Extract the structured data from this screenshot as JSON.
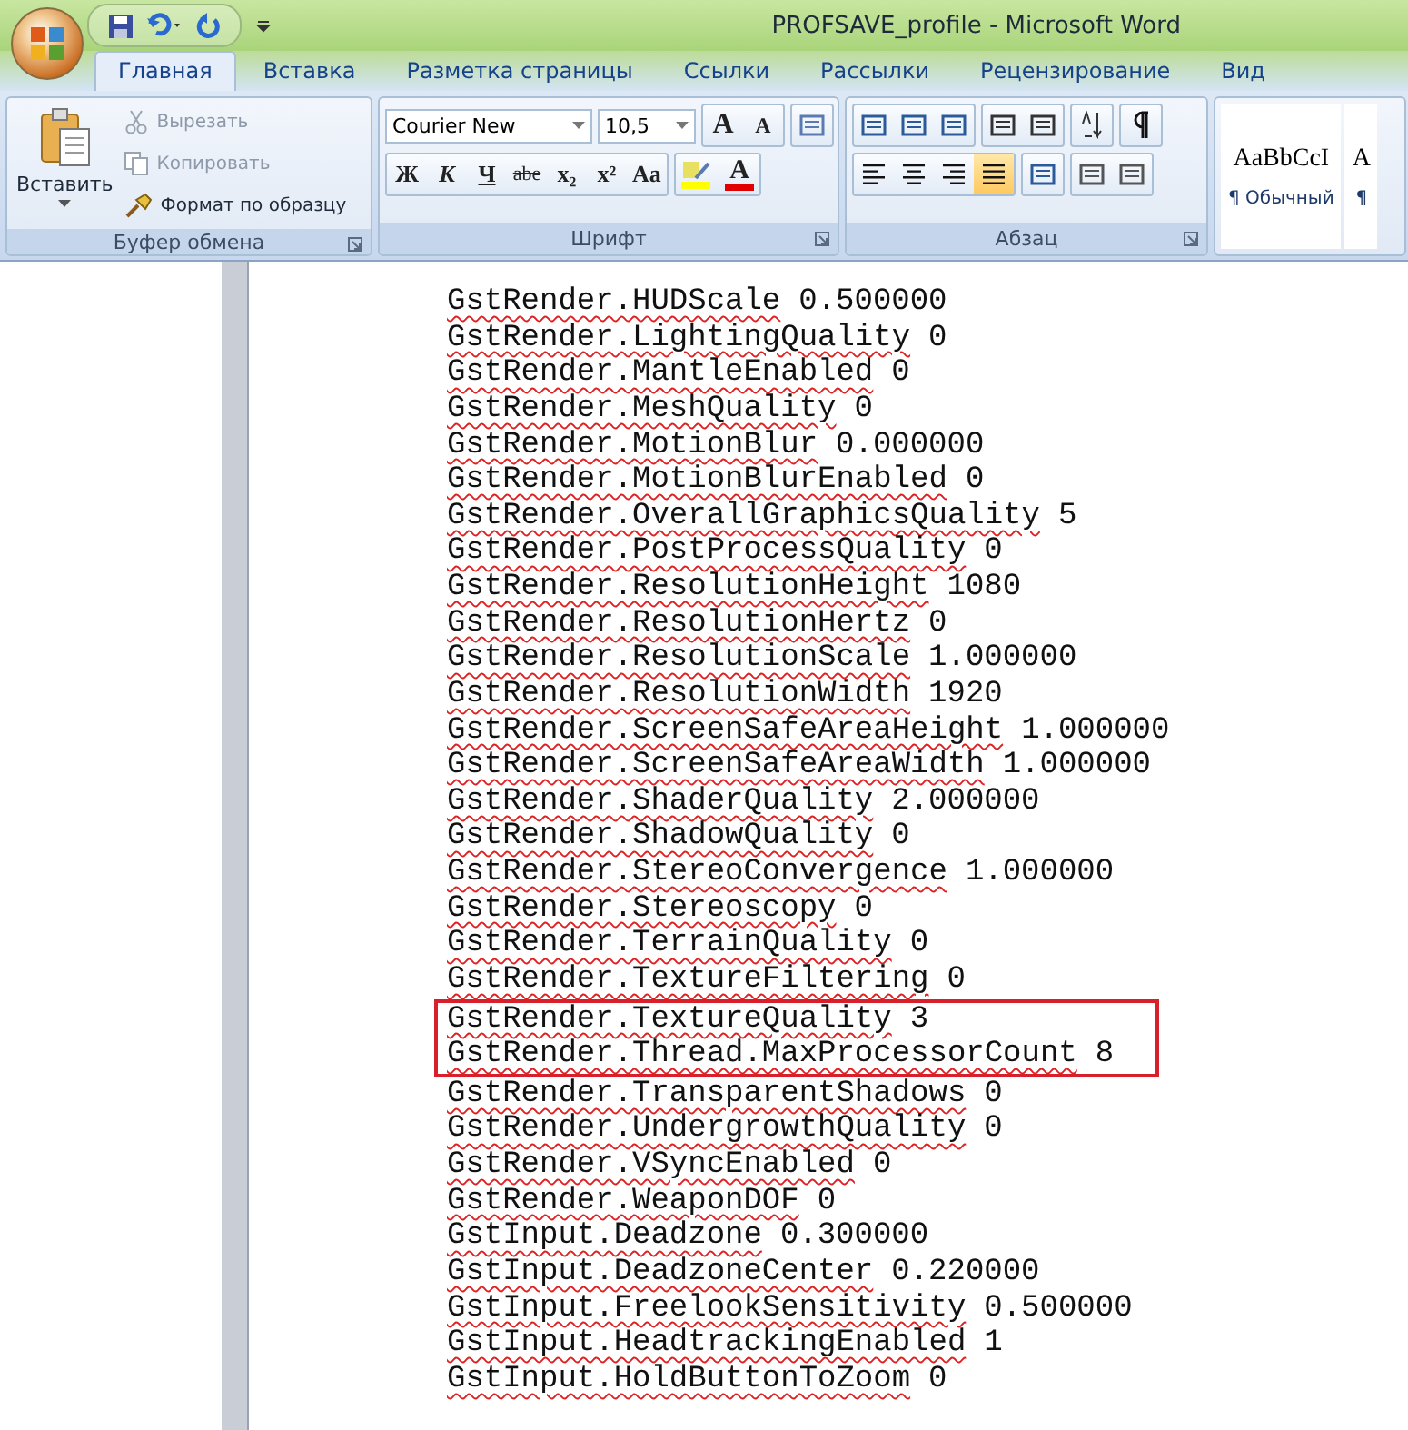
{
  "window": {
    "title": "PROFSAVE_profile - Microsoft Word"
  },
  "tabs": [
    {
      "label": "Главная",
      "selected": true
    },
    {
      "label": "Вставка",
      "selected": false
    },
    {
      "label": "Разметка страницы",
      "selected": false
    },
    {
      "label": "Ссылки",
      "selected": false
    },
    {
      "label": "Рассылки",
      "selected": false
    },
    {
      "label": "Рецензирование",
      "selected": false
    },
    {
      "label": "Вид",
      "selected": false
    }
  ],
  "clipboard": {
    "label": "Буфер обмена",
    "paste": "Вставить",
    "cut": {
      "label": "Вырезать",
      "disabled": true
    },
    "copy": {
      "label": "Копировать",
      "disabled": true
    },
    "painter": {
      "label": "Формат по образцу",
      "disabled": false
    }
  },
  "font": {
    "label": "Шрифт",
    "name": "Courier New",
    "size": "10,5",
    "grow": "A",
    "shrink": "A",
    "bold": "Ж",
    "italic": "К",
    "underline": "Ч",
    "strike": "abe",
    "subscript": "x₂",
    "superscript": "x²",
    "case": "Aa",
    "color_letter": "A"
  },
  "paragraph": {
    "label": "Абзац",
    "align": [
      {
        "kind": "left",
        "selected": false
      },
      {
        "kind": "center",
        "selected": false
      },
      {
        "kind": "right",
        "selected": false
      },
      {
        "kind": "justify",
        "selected": true
      }
    ]
  },
  "styles": [
    {
      "sample": "AaBbCcI",
      "name": "¶ Обычный"
    },
    {
      "sample": "A",
      "name": "¶"
    }
  ],
  "document": {
    "lines": [
      {
        "key": "GstRender.HUDScale",
        "value": "0.500000",
        "boxed": false
      },
      {
        "key": "GstRender.LightingQuality",
        "value": "0",
        "boxed": false
      },
      {
        "key": "GstRender.MantleEnabled",
        "value": "0",
        "boxed": false
      },
      {
        "key": "GstRender.MeshQuality",
        "value": "0",
        "boxed": false
      },
      {
        "key": "GstRender.MotionBlur",
        "value": "0.000000",
        "boxed": false
      },
      {
        "key": "GstRender.MotionBlurEnabled",
        "value": "0",
        "boxed": false
      },
      {
        "key": "GstRender.OverallGraphicsQuality",
        "value": "5",
        "boxed": false
      },
      {
        "key": "GstRender.PostProcessQuality",
        "value": "0",
        "boxed": false
      },
      {
        "key": "GstRender.ResolutionHeight",
        "value": "1080",
        "boxed": false
      },
      {
        "key": "GstRender.ResolutionHertz",
        "value": "0",
        "boxed": false
      },
      {
        "key": "GstRender.ResolutionScale",
        "value": "1.000000",
        "boxed": false
      },
      {
        "key": "GstRender.ResolutionWidth",
        "value": "1920",
        "boxed": false
      },
      {
        "key": "GstRender.ScreenSafeAreaHeight",
        "value": "1.000000",
        "boxed": false
      },
      {
        "key": "GstRender.ScreenSafeAreaWidth",
        "value": "1.000000",
        "boxed": false
      },
      {
        "key": "GstRender.ShaderQuality",
        "value": "2.000000",
        "boxed": false
      },
      {
        "key": "GstRender.ShadowQuality",
        "value": "0",
        "boxed": false
      },
      {
        "key": "GstRender.StereoConvergence",
        "value": "1.000000",
        "boxed": false
      },
      {
        "key": "GstRender.Stereoscopy",
        "value": "0",
        "boxed": false
      },
      {
        "key": "GstRender.TerrainQuality",
        "value": "0",
        "boxed": false
      },
      {
        "key": "GstRender.TextureFiltering",
        "value": "0",
        "boxed": false
      },
      {
        "key": "GstRender.TextureQuality",
        "value": "3",
        "boxed": true
      },
      {
        "key": "GstRender.Thread.MaxProcessorCount",
        "value": "8",
        "boxed": true
      },
      {
        "key": "GstRender.TransparentShadows",
        "value": "0",
        "boxed": false
      },
      {
        "key": "GstRender.UndergrowthQuality",
        "value": "0",
        "boxed": false
      },
      {
        "key": "GstRender.VSyncEnabled",
        "value": "0",
        "boxed": false
      },
      {
        "key": "GstRender.WeaponDOF",
        "value": "0",
        "boxed": false
      },
      {
        "key": "GstInput.Deadzone",
        "value": "0.300000",
        "boxed": false
      },
      {
        "key": "GstInput.DeadzoneCenter",
        "value": "0.220000",
        "boxed": false
      },
      {
        "key": "GstInput.FreelookSensitivity",
        "value": "0.500000",
        "boxed": false
      },
      {
        "key": "GstInput.HeadtrackingEnabled",
        "value": "1",
        "boxed": false
      },
      {
        "key": "GstInput.HoldButtonToZoom",
        "value": "0",
        "boxed": false
      }
    ]
  }
}
